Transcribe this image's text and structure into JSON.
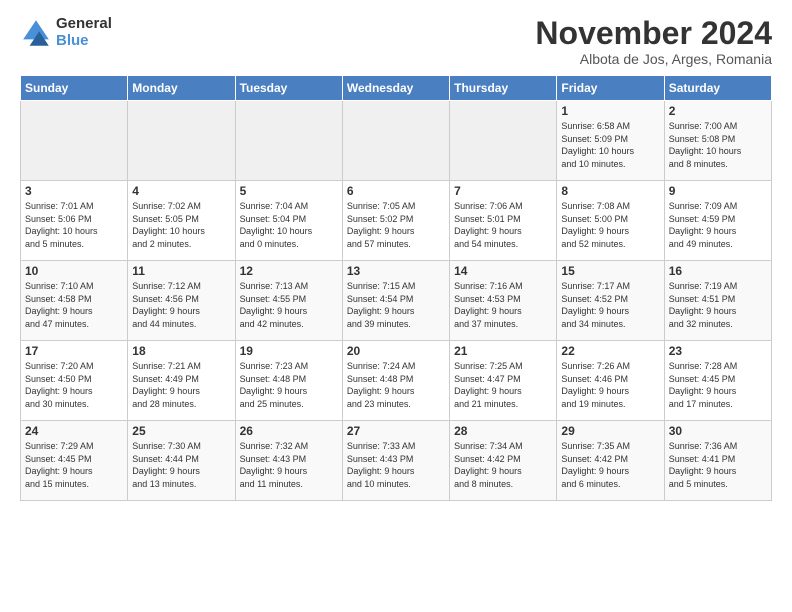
{
  "logo": {
    "general": "General",
    "blue": "Blue"
  },
  "title": "November 2024",
  "location": "Albota de Jos, Arges, Romania",
  "weekdays": [
    "Sunday",
    "Monday",
    "Tuesday",
    "Wednesday",
    "Thursday",
    "Friday",
    "Saturday"
  ],
  "weeks": [
    [
      {
        "day": "",
        "info": ""
      },
      {
        "day": "",
        "info": ""
      },
      {
        "day": "",
        "info": ""
      },
      {
        "day": "",
        "info": ""
      },
      {
        "day": "",
        "info": ""
      },
      {
        "day": "1",
        "info": "Sunrise: 6:58 AM\nSunset: 5:09 PM\nDaylight: 10 hours\nand 10 minutes."
      },
      {
        "day": "2",
        "info": "Sunrise: 7:00 AM\nSunset: 5:08 PM\nDaylight: 10 hours\nand 8 minutes."
      }
    ],
    [
      {
        "day": "3",
        "info": "Sunrise: 7:01 AM\nSunset: 5:06 PM\nDaylight: 10 hours\nand 5 minutes."
      },
      {
        "day": "4",
        "info": "Sunrise: 7:02 AM\nSunset: 5:05 PM\nDaylight: 10 hours\nand 2 minutes."
      },
      {
        "day": "5",
        "info": "Sunrise: 7:04 AM\nSunset: 5:04 PM\nDaylight: 10 hours\nand 0 minutes."
      },
      {
        "day": "6",
        "info": "Sunrise: 7:05 AM\nSunset: 5:02 PM\nDaylight: 9 hours\nand 57 minutes."
      },
      {
        "day": "7",
        "info": "Sunrise: 7:06 AM\nSunset: 5:01 PM\nDaylight: 9 hours\nand 54 minutes."
      },
      {
        "day": "8",
        "info": "Sunrise: 7:08 AM\nSunset: 5:00 PM\nDaylight: 9 hours\nand 52 minutes."
      },
      {
        "day": "9",
        "info": "Sunrise: 7:09 AM\nSunset: 4:59 PM\nDaylight: 9 hours\nand 49 minutes."
      }
    ],
    [
      {
        "day": "10",
        "info": "Sunrise: 7:10 AM\nSunset: 4:58 PM\nDaylight: 9 hours\nand 47 minutes."
      },
      {
        "day": "11",
        "info": "Sunrise: 7:12 AM\nSunset: 4:56 PM\nDaylight: 9 hours\nand 44 minutes."
      },
      {
        "day": "12",
        "info": "Sunrise: 7:13 AM\nSunset: 4:55 PM\nDaylight: 9 hours\nand 42 minutes."
      },
      {
        "day": "13",
        "info": "Sunrise: 7:15 AM\nSunset: 4:54 PM\nDaylight: 9 hours\nand 39 minutes."
      },
      {
        "day": "14",
        "info": "Sunrise: 7:16 AM\nSunset: 4:53 PM\nDaylight: 9 hours\nand 37 minutes."
      },
      {
        "day": "15",
        "info": "Sunrise: 7:17 AM\nSunset: 4:52 PM\nDaylight: 9 hours\nand 34 minutes."
      },
      {
        "day": "16",
        "info": "Sunrise: 7:19 AM\nSunset: 4:51 PM\nDaylight: 9 hours\nand 32 minutes."
      }
    ],
    [
      {
        "day": "17",
        "info": "Sunrise: 7:20 AM\nSunset: 4:50 PM\nDaylight: 9 hours\nand 30 minutes."
      },
      {
        "day": "18",
        "info": "Sunrise: 7:21 AM\nSunset: 4:49 PM\nDaylight: 9 hours\nand 28 minutes."
      },
      {
        "day": "19",
        "info": "Sunrise: 7:23 AM\nSunset: 4:48 PM\nDaylight: 9 hours\nand 25 minutes."
      },
      {
        "day": "20",
        "info": "Sunrise: 7:24 AM\nSunset: 4:48 PM\nDaylight: 9 hours\nand 23 minutes."
      },
      {
        "day": "21",
        "info": "Sunrise: 7:25 AM\nSunset: 4:47 PM\nDaylight: 9 hours\nand 21 minutes."
      },
      {
        "day": "22",
        "info": "Sunrise: 7:26 AM\nSunset: 4:46 PM\nDaylight: 9 hours\nand 19 minutes."
      },
      {
        "day": "23",
        "info": "Sunrise: 7:28 AM\nSunset: 4:45 PM\nDaylight: 9 hours\nand 17 minutes."
      }
    ],
    [
      {
        "day": "24",
        "info": "Sunrise: 7:29 AM\nSunset: 4:45 PM\nDaylight: 9 hours\nand 15 minutes."
      },
      {
        "day": "25",
        "info": "Sunrise: 7:30 AM\nSunset: 4:44 PM\nDaylight: 9 hours\nand 13 minutes."
      },
      {
        "day": "26",
        "info": "Sunrise: 7:32 AM\nSunset: 4:43 PM\nDaylight: 9 hours\nand 11 minutes."
      },
      {
        "day": "27",
        "info": "Sunrise: 7:33 AM\nSunset: 4:43 PM\nDaylight: 9 hours\nand 10 minutes."
      },
      {
        "day": "28",
        "info": "Sunrise: 7:34 AM\nSunset: 4:42 PM\nDaylight: 9 hours\nand 8 minutes."
      },
      {
        "day": "29",
        "info": "Sunrise: 7:35 AM\nSunset: 4:42 PM\nDaylight: 9 hours\nand 6 minutes."
      },
      {
        "day": "30",
        "info": "Sunrise: 7:36 AM\nSunset: 4:41 PM\nDaylight: 9 hours\nand 5 minutes."
      }
    ]
  ]
}
